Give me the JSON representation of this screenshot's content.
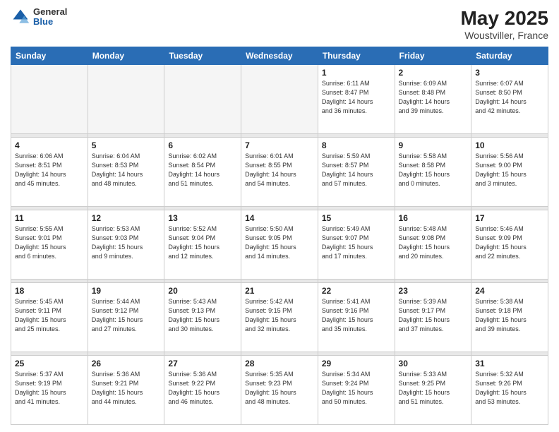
{
  "header": {
    "logo": {
      "line1": "General",
      "line2": "Blue"
    },
    "title": "May 2025",
    "location": "Woustviller, France"
  },
  "weekdays": [
    "Sunday",
    "Monday",
    "Tuesday",
    "Wednesday",
    "Thursday",
    "Friday",
    "Saturday"
  ],
  "weeks": [
    [
      {
        "day": "",
        "content": ""
      },
      {
        "day": "",
        "content": ""
      },
      {
        "day": "",
        "content": ""
      },
      {
        "day": "",
        "content": ""
      },
      {
        "day": "1",
        "content": "Sunrise: 6:11 AM\nSunset: 8:47 PM\nDaylight: 14 hours\nand 36 minutes."
      },
      {
        "day": "2",
        "content": "Sunrise: 6:09 AM\nSunset: 8:48 PM\nDaylight: 14 hours\nand 39 minutes."
      },
      {
        "day": "3",
        "content": "Sunrise: 6:07 AM\nSunset: 8:50 PM\nDaylight: 14 hours\nand 42 minutes."
      }
    ],
    [
      {
        "day": "4",
        "content": "Sunrise: 6:06 AM\nSunset: 8:51 PM\nDaylight: 14 hours\nand 45 minutes."
      },
      {
        "day": "5",
        "content": "Sunrise: 6:04 AM\nSunset: 8:53 PM\nDaylight: 14 hours\nand 48 minutes."
      },
      {
        "day": "6",
        "content": "Sunrise: 6:02 AM\nSunset: 8:54 PM\nDaylight: 14 hours\nand 51 minutes."
      },
      {
        "day": "7",
        "content": "Sunrise: 6:01 AM\nSunset: 8:55 PM\nDaylight: 14 hours\nand 54 minutes."
      },
      {
        "day": "8",
        "content": "Sunrise: 5:59 AM\nSunset: 8:57 PM\nDaylight: 14 hours\nand 57 minutes."
      },
      {
        "day": "9",
        "content": "Sunrise: 5:58 AM\nSunset: 8:58 PM\nDaylight: 15 hours\nand 0 minutes."
      },
      {
        "day": "10",
        "content": "Sunrise: 5:56 AM\nSunset: 9:00 PM\nDaylight: 15 hours\nand 3 minutes."
      }
    ],
    [
      {
        "day": "11",
        "content": "Sunrise: 5:55 AM\nSunset: 9:01 PM\nDaylight: 15 hours\nand 6 minutes."
      },
      {
        "day": "12",
        "content": "Sunrise: 5:53 AM\nSunset: 9:03 PM\nDaylight: 15 hours\nand 9 minutes."
      },
      {
        "day": "13",
        "content": "Sunrise: 5:52 AM\nSunset: 9:04 PM\nDaylight: 15 hours\nand 12 minutes."
      },
      {
        "day": "14",
        "content": "Sunrise: 5:50 AM\nSunset: 9:05 PM\nDaylight: 15 hours\nand 14 minutes."
      },
      {
        "day": "15",
        "content": "Sunrise: 5:49 AM\nSunset: 9:07 PM\nDaylight: 15 hours\nand 17 minutes."
      },
      {
        "day": "16",
        "content": "Sunrise: 5:48 AM\nSunset: 9:08 PM\nDaylight: 15 hours\nand 20 minutes."
      },
      {
        "day": "17",
        "content": "Sunrise: 5:46 AM\nSunset: 9:09 PM\nDaylight: 15 hours\nand 22 minutes."
      }
    ],
    [
      {
        "day": "18",
        "content": "Sunrise: 5:45 AM\nSunset: 9:11 PM\nDaylight: 15 hours\nand 25 minutes."
      },
      {
        "day": "19",
        "content": "Sunrise: 5:44 AM\nSunset: 9:12 PM\nDaylight: 15 hours\nand 27 minutes."
      },
      {
        "day": "20",
        "content": "Sunrise: 5:43 AM\nSunset: 9:13 PM\nDaylight: 15 hours\nand 30 minutes."
      },
      {
        "day": "21",
        "content": "Sunrise: 5:42 AM\nSunset: 9:15 PM\nDaylight: 15 hours\nand 32 minutes."
      },
      {
        "day": "22",
        "content": "Sunrise: 5:41 AM\nSunset: 9:16 PM\nDaylight: 15 hours\nand 35 minutes."
      },
      {
        "day": "23",
        "content": "Sunrise: 5:39 AM\nSunset: 9:17 PM\nDaylight: 15 hours\nand 37 minutes."
      },
      {
        "day": "24",
        "content": "Sunrise: 5:38 AM\nSunset: 9:18 PM\nDaylight: 15 hours\nand 39 minutes."
      }
    ],
    [
      {
        "day": "25",
        "content": "Sunrise: 5:37 AM\nSunset: 9:19 PM\nDaylight: 15 hours\nand 41 minutes."
      },
      {
        "day": "26",
        "content": "Sunrise: 5:36 AM\nSunset: 9:21 PM\nDaylight: 15 hours\nand 44 minutes."
      },
      {
        "day": "27",
        "content": "Sunrise: 5:36 AM\nSunset: 9:22 PM\nDaylight: 15 hours\nand 46 minutes."
      },
      {
        "day": "28",
        "content": "Sunrise: 5:35 AM\nSunset: 9:23 PM\nDaylight: 15 hours\nand 48 minutes."
      },
      {
        "day": "29",
        "content": "Sunrise: 5:34 AM\nSunset: 9:24 PM\nDaylight: 15 hours\nand 50 minutes."
      },
      {
        "day": "30",
        "content": "Sunrise: 5:33 AM\nSunset: 9:25 PM\nDaylight: 15 hours\nand 51 minutes."
      },
      {
        "day": "31",
        "content": "Sunrise: 5:32 AM\nSunset: 9:26 PM\nDaylight: 15 hours\nand 53 minutes."
      }
    ]
  ]
}
